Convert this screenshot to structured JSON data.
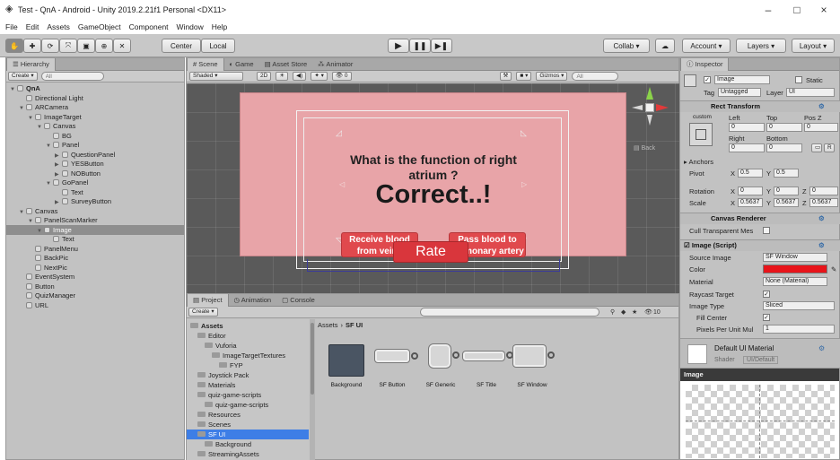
{
  "window": {
    "title": "Test - QnA - Android - Unity 2019.2.21f1 Personal <DX11>",
    "minimize": "–",
    "maximize": "□",
    "close": "×"
  },
  "menu": [
    "File",
    "Edit",
    "Assets",
    "GameObject",
    "Component",
    "Window",
    "Help"
  ],
  "toolbar": {
    "pivot": "Center",
    "space": "Local",
    "collab": "Collab",
    "account": "Account",
    "layers": "Layers",
    "layout": "Layout"
  },
  "hierarchy": {
    "tab": "Hierarchy",
    "create": "Create",
    "search_placeholder": "All",
    "items": [
      {
        "label": "QnA",
        "depth": 0
      },
      {
        "label": "Directional Light",
        "depth": 1
      },
      {
        "label": "ARCamera",
        "depth": 1
      },
      {
        "label": "ImageTarget",
        "depth": 2
      },
      {
        "label": "Canvas",
        "depth": 3
      },
      {
        "label": "BG",
        "depth": 4
      },
      {
        "label": "Panel",
        "depth": 4
      },
      {
        "label": "QuestionPanel",
        "depth": 5
      },
      {
        "label": "YESButton",
        "depth": 5
      },
      {
        "label": "NOButton",
        "depth": 5
      },
      {
        "label": "GoPanel",
        "depth": 4
      },
      {
        "label": "Text",
        "depth": 5
      },
      {
        "label": "SurveyButton",
        "depth": 5
      },
      {
        "label": "Canvas",
        "depth": 1
      },
      {
        "label": "PanelScanMarker",
        "depth": 2
      },
      {
        "label": "Image",
        "depth": 3
      },
      {
        "label": "Text",
        "depth": 4
      },
      {
        "label": "PanelMenu",
        "depth": 2
      },
      {
        "label": "BackPic",
        "depth": 2
      },
      {
        "label": "NextPic",
        "depth": 2
      },
      {
        "label": "EventSystem",
        "depth": 1
      },
      {
        "label": "Button",
        "depth": 1
      },
      {
        "label": "QuizManager",
        "depth": 1
      },
      {
        "label": "URL",
        "depth": 1
      }
    ]
  },
  "scene": {
    "tabs": [
      "Scene",
      "Game",
      "Asset Store",
      "Animator"
    ],
    "shading": "Shaded",
    "mode_2d": "2D",
    "gizmos": "Gizmos",
    "search_placeholder": "All",
    "back_label": "Back",
    "question": "What is the function of right atrium ?",
    "feedback": "Correct..!",
    "option_left": "Receive blood from veins",
    "option_right": "Pass blood to pulmonary artery",
    "rate_button": "Rate"
  },
  "project": {
    "tabs": [
      "Project",
      "Animation",
      "Console"
    ],
    "create": "Create",
    "count": "10",
    "breadcrumb": [
      "Assets",
      "SF UI"
    ],
    "tree": [
      {
        "label": "Assets",
        "depth": 0
      },
      {
        "label": "Editor",
        "depth": 1
      },
      {
        "label": "Vuforia",
        "depth": 2
      },
      {
        "label": "ImageTargetTextures",
        "depth": 3
      },
      {
        "label": "FYP",
        "depth": 4
      },
      {
        "label": "Joystick Pack",
        "depth": 1
      },
      {
        "label": "Materials",
        "depth": 1
      },
      {
        "label": "quiz-game-scripts",
        "depth": 1
      },
      {
        "label": "quiz-game-scripts",
        "depth": 2
      },
      {
        "label": "Resources",
        "depth": 1
      },
      {
        "label": "Scenes",
        "depth": 1
      },
      {
        "label": "SF UI",
        "depth": 1
      },
      {
        "label": "Background",
        "depth": 2
      },
      {
        "label": "StreamingAssets",
        "depth": 1
      }
    ],
    "assets": [
      "Background",
      "SF Button",
      "SF Generic",
      "SF Title",
      "SF Window"
    ]
  },
  "inspector": {
    "tab": "Inspector",
    "object_name": "Image",
    "static": "Static",
    "tag_label": "Tag",
    "tag": "Untagged",
    "layer_label": "Layer",
    "layer": "UI",
    "rect_transform": "Rect Transform",
    "custom": "custom",
    "left": "Left",
    "top": "Top",
    "posz": "Pos Z",
    "left_val": "0",
    "top_val": "0",
    "posz_val": "0",
    "right": "Right",
    "bottom": "Bottom",
    "right_val": "0",
    "bottom_val": "0",
    "r_button": "R",
    "anchors": "Anchors",
    "pivot": "Pivot",
    "pivot_x": "0.5",
    "pivot_y": "0.5",
    "rotation": "Rotation",
    "rot_x": "0",
    "rot_y": "0",
    "rot_z": "0",
    "scale": "Scale",
    "scale_x": "0.5637",
    "scale_y": "0.5637",
    "scale_z": "0.5637",
    "canvas_renderer": "Canvas Renderer",
    "cull": "Cull Transparent Mes",
    "image_script": "Image (Script)",
    "source_image": "Source Image",
    "source_val": "SF Window",
    "color": "Color",
    "color_val": "#e8141a",
    "material": "Material",
    "material_val": "None (Material)",
    "raycast": "Raycast Target",
    "image_type": "Image Type",
    "image_type_val": "Sliced",
    "fill_center": "Fill Center",
    "pixels_per_unit": "Pixels Per Unit Mul",
    "pixels_val": "1",
    "default_material": "Default UI Material",
    "shader": "Shader",
    "shader_val": "UI/Default"
  },
  "preview": {
    "title": "Image"
  },
  "colors": {
    "panel_pink": "#e8a4a8",
    "button_red": "#e0494d",
    "rate_red": "#d9363c",
    "selection": "#3e7ee6"
  }
}
